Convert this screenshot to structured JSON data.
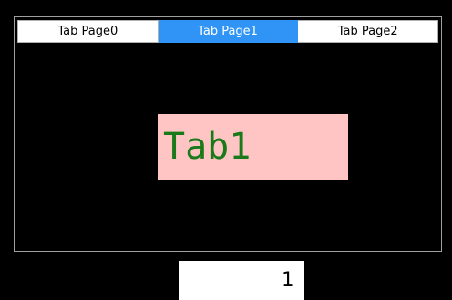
{
  "tabs": [
    {
      "label": "Tab Page0",
      "selected": false
    },
    {
      "label": "Tab Page1",
      "selected": true
    },
    {
      "label": "Tab Page2",
      "selected": false
    }
  ],
  "content": {
    "text": "Tab1",
    "background": "#ffc4c4",
    "text_color": "#1a7a1a"
  },
  "selected_index_display": "1",
  "colors": {
    "background": "#000000",
    "selected_tab": "#2f94f5"
  }
}
